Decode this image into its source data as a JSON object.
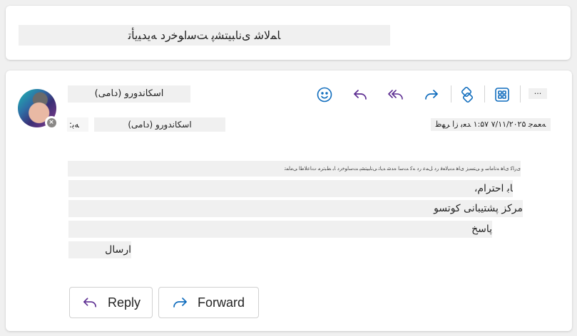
{
  "subject": "ﺎﻤﻟﺎﺷ ﯼﻧﺎﺒﯿﺘﺸﭘ ﺖﺳﺍﻮﺧﺭﺩ ﻪﯾﺪﯿﯾﺄﺗ",
  "sender": {
    "name": "ﺍﺳﮑﺎﻧﺪﻭﺭﻭ (ﺩﺎﻣﯽ)",
    "status_icon": "blocked-status-icon"
  },
  "recipients": {
    "to_label": "ﻪﺑ:",
    "to_name": "ﺍﺳﮑﺎﻧﺪﻭﺭﻭ (ﺩﺎﻣﯽ)"
  },
  "date": "ﻪﻌﻤﺟ ۷/۱۱/۲۰۲۵ ۱:۵۷ ﺪﻌﺑ ﺯﺍ ﺮﻬﻇ",
  "toolbar": {
    "icons": [
      "emoji-icon",
      "reply-icon",
      "reply-all-icon",
      "forward-icon",
      "sticker-icon",
      "apps-icon"
    ],
    "more_label": "..."
  },
  "body": {
    "header_line": "ﯼﺭﺎﮐ ﯼﺎﻫ ﻪﻧﺎﻣﺎﺳ ﻭ ﯽﺘﺴﯾﺯ ﯼﺎﻫ ﺖﯿﻟﺎﻌﻓ ﺭﺩ ﻞﻤﻋ ﺭﺩ ﻪﮐ ﺖﺳﺍ ﻩﺪﺷ ﺪﯾﺎﺗ ﯽﻧﺎﺒﯿﺘﺸﭘ ﺖﺳﺍﻮﺧﺭﺩ ﺎﺑ ﻂﺒﺗﺮﻣ ﺕﺎﻋﻼﻃﺍ ﯽﻣﺎﻤﺗ",
    "lines": [
      "ﺎﺑ ﺍﺣﺘﺮﺍﻡ،",
      "ﻣﺮﮐﺰ ﭘﺸﺘﯿﺒﺎﻧﯽ ﮐﻮﺗﺴﻮ",
      "ﭘﺎﺳﺦ",
      "ﺍﺭﺳﺎﻝ"
    ]
  },
  "actions": {
    "reply_label": "Reply",
    "forward_label": "Forward"
  },
  "colors": {
    "accent": "#5c2d91",
    "icon_blue": "#0f6cbd"
  }
}
